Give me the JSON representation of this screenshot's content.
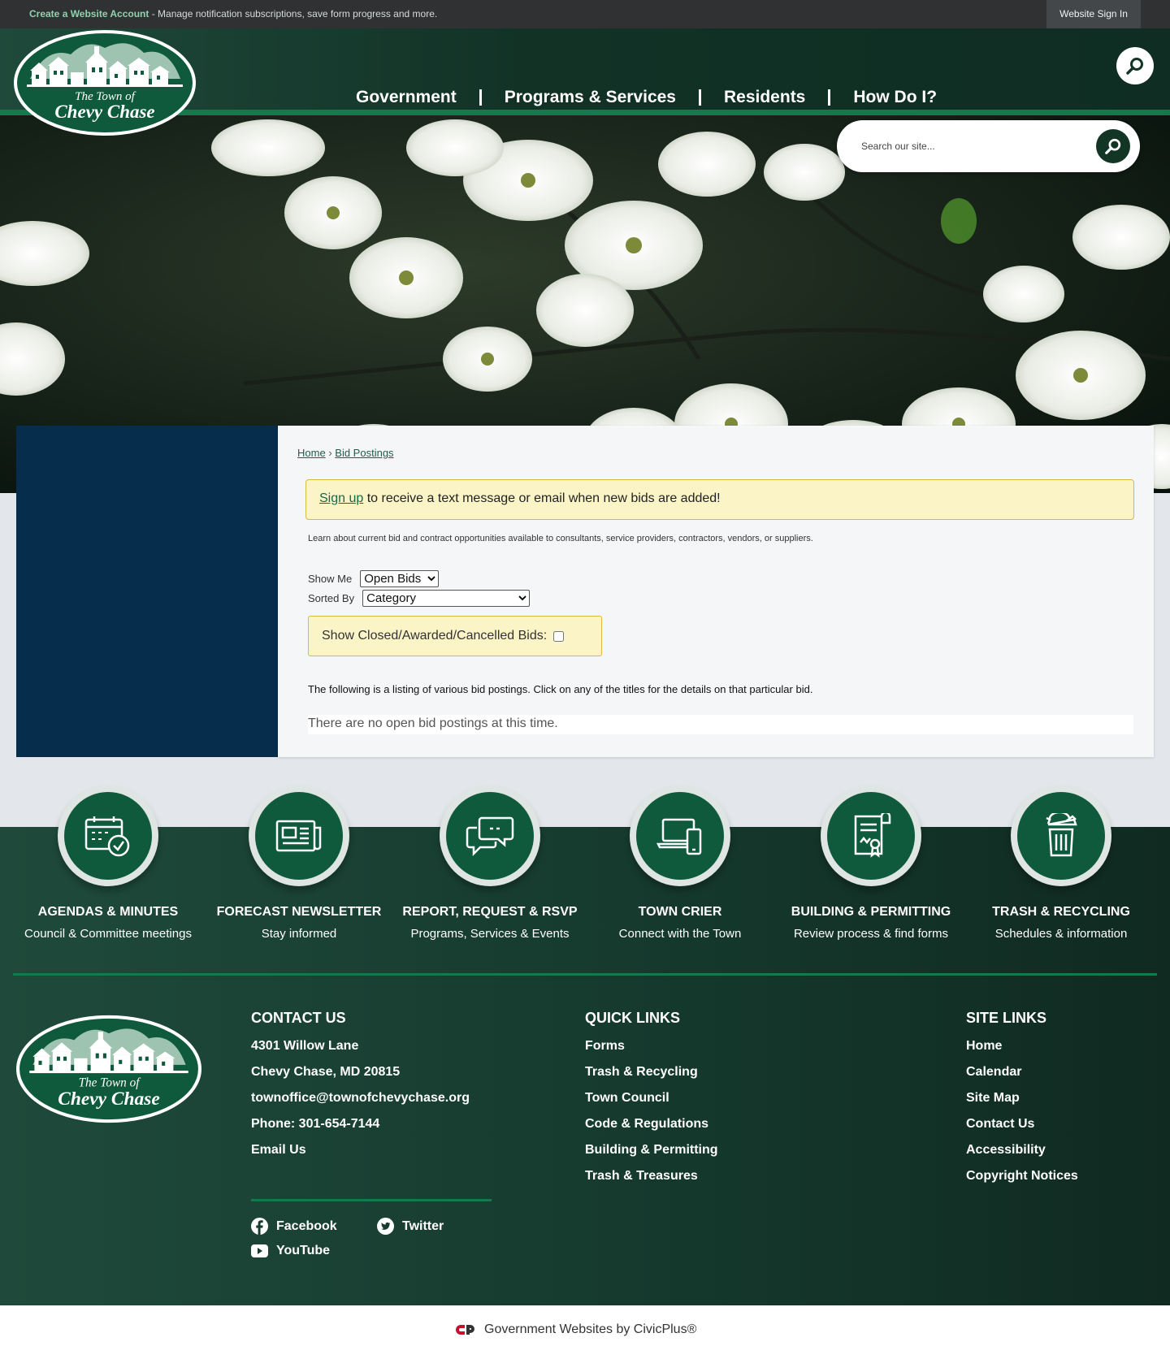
{
  "top_bar": {
    "create_account_link": "Create a Website Account",
    "create_account_text": " - Manage notification subscriptions, save form progress and more.",
    "sign_in": "Website Sign In"
  },
  "logo": {
    "line1": "The Town of",
    "line2": "Chevy Chase"
  },
  "nav": [
    "Government",
    "Programs & Services",
    "Residents",
    "How Do I?"
  ],
  "site_search": {
    "placeholder": "Search our site..."
  },
  "breadcrumb": {
    "home": "Home",
    "separator": "›",
    "current": "Bid Postings"
  },
  "notice": {
    "link": "Sign up",
    "text": " to receive a text message or email when new bids are added!"
  },
  "intro": "Learn about current bid and contract opportunities available to consultants, service providers, contractors, vendors, or suppliers.",
  "filters": {
    "show_me_label": "Show Me",
    "show_me_value": "Open Bids",
    "sorted_by_label": "Sorted By",
    "sorted_by_value": "Category",
    "closed_label": "Show Closed/Awarded/Cancelled Bids:"
  },
  "listing_text": "The following is a listing of various bid postings. Click on any of the titles for the details on that particular bid.",
  "empty_text": "There are no open bid postings at this time.",
  "quick_links": [
    {
      "title": "AGENDAS & MINUTES",
      "subtitle": "Council & Committee meetings",
      "icon": "calendar-check-icon"
    },
    {
      "title": "FORECAST NEWSLETTER",
      "subtitle": "Stay informed",
      "icon": "newspaper-icon"
    },
    {
      "title": "REPORT, REQUEST & RSVP",
      "subtitle": "Programs, Services & Events",
      "icon": "chat-bubbles-icon"
    },
    {
      "title": "TOWN CRIER",
      "subtitle": "Connect with the Town",
      "icon": "devices-icon"
    },
    {
      "title": "BUILDING & PERMITTING",
      "subtitle": "Review process & find forms",
      "icon": "permit-document-icon"
    },
    {
      "title": "TRASH & RECYCLING",
      "subtitle": "Schedules & information",
      "icon": "trash-can-icon"
    }
  ],
  "contact": {
    "heading": "CONTACT US",
    "address1": "4301 Willow Lane",
    "address2": "Chevy Chase, MD 20815",
    "email": "townoffice@townofchevychase.org",
    "phone": "Phone: 301-654-7144",
    "email_us": "Email Us"
  },
  "social": {
    "facebook": "Facebook",
    "twitter": "Twitter",
    "youtube": "YouTube"
  },
  "quick_links_footer": {
    "heading": "QUICK LINKS",
    "items": [
      "Forms",
      "Trash & Recycling",
      "Town Council",
      "Code & Regulations",
      "Building & Permitting",
      "Trash & Treasures"
    ]
  },
  "site_links": {
    "heading": "SITE LINKS",
    "items": [
      "Home",
      "Calendar",
      "Site Map",
      "Contact Us",
      "Accessibility",
      "Copyright Notices"
    ]
  },
  "footer_credit": "Government Websites by CivicPlus®",
  "colors": {
    "brand_green": "#137a4d",
    "dark_green": "#123526",
    "sidebar_navy": "#062d4c",
    "notice_yellow": "#fbf4c7"
  }
}
